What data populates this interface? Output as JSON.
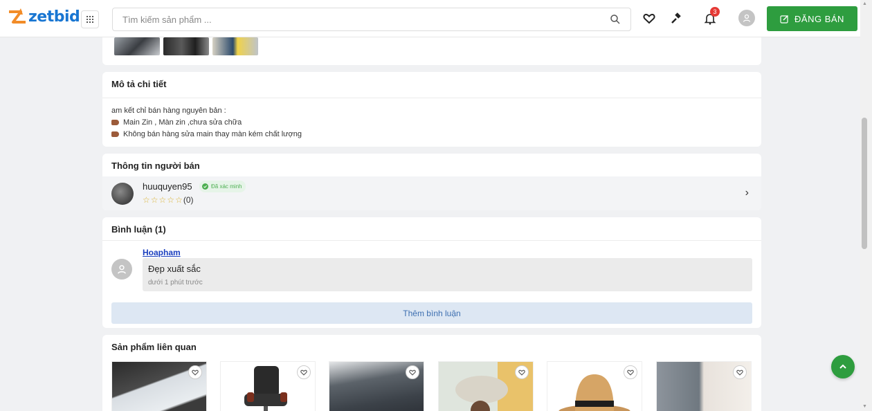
{
  "header": {
    "logo_text": "zetbid",
    "search_placeholder": "Tìm kiếm sản phẩm ...",
    "notification_count": "3",
    "sell_button_label": "ĐĂNG BÁN"
  },
  "description": {
    "title": "Mô tả chi tiết",
    "lines": [
      "am kết chỉ bán hàng nguyên bản :",
      "Main Zin , Màn zin ,chưa sửa chữa",
      "Không bán hàng sửa main thay màn kém chất lượng"
    ]
  },
  "seller": {
    "title": "Thông tin người bán",
    "username": "huuquyen95",
    "verified_label": "Đã xác minh",
    "rating_count": "(0)"
  },
  "comments": {
    "title": "Bình luận (1)",
    "items": [
      {
        "user": "Hoapham",
        "text": "Đẹp xuất sắc",
        "time": "dưới 1 phút trước"
      }
    ],
    "more_label": "Thêm bình luận"
  },
  "related": {
    "title": "Sản phẩm liên quan",
    "products": [
      {
        "image": "phone-in-hand"
      },
      {
        "image": "office-chair"
      },
      {
        "image": "laptop"
      },
      {
        "image": "bucket-hat"
      },
      {
        "image": "straw-hat"
      },
      {
        "image": "fashion-couple"
      }
    ]
  },
  "colors": {
    "brand_blue": "#1976d2",
    "brand_green": "#2e9d3f",
    "badge_red": "#e53935",
    "link_blue": "#1a3fbf"
  }
}
